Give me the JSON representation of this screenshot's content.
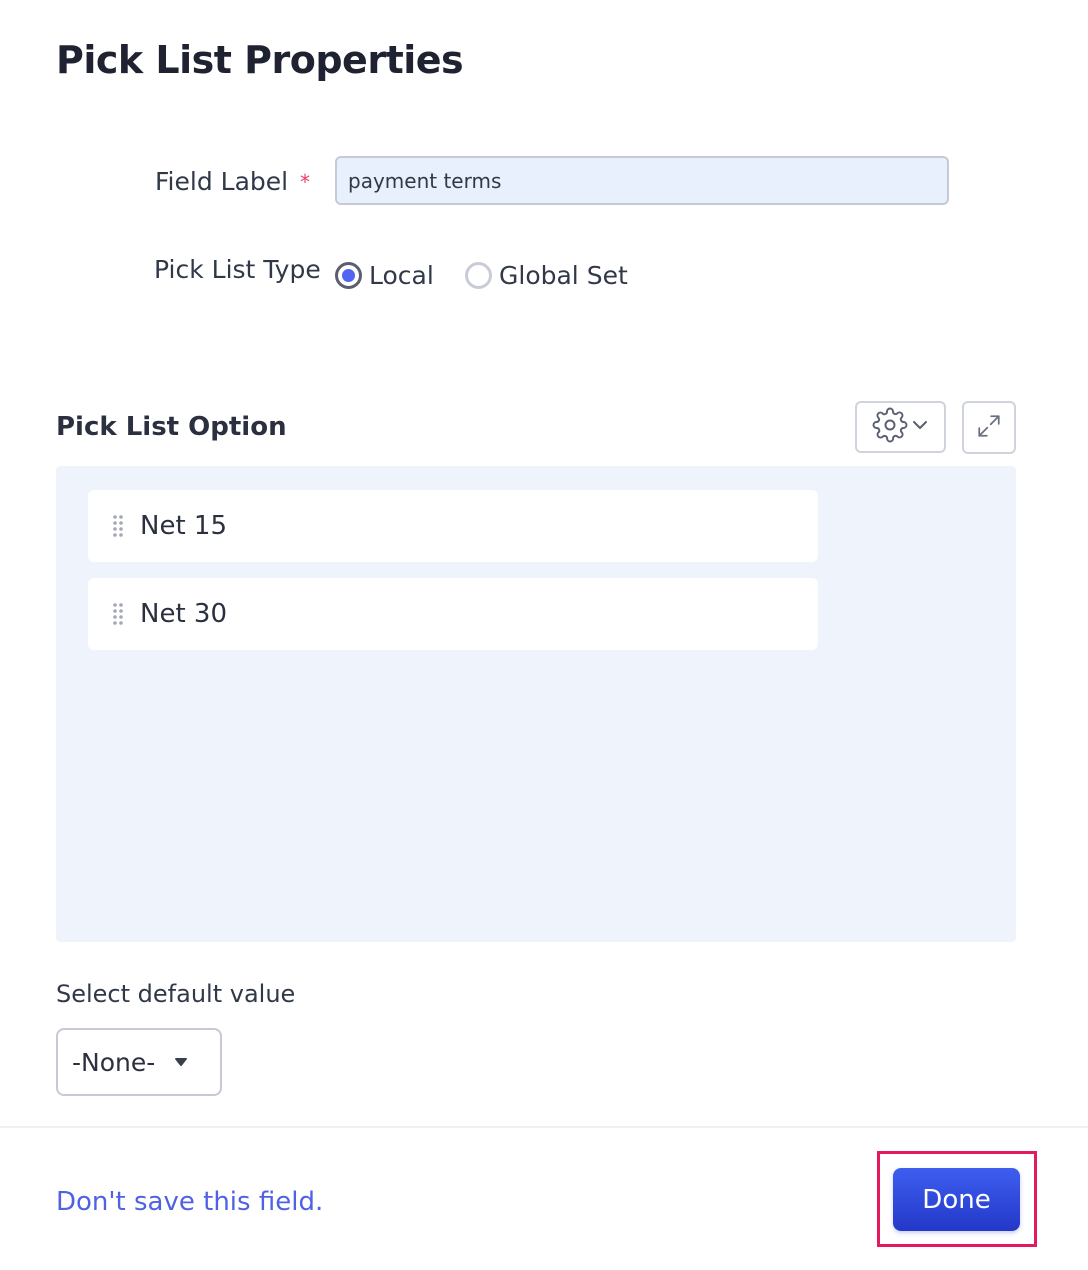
{
  "dialog": {
    "title": "Pick List Properties"
  },
  "field_label": {
    "label": "Field Label",
    "required_marker": "*",
    "value": "payment terms"
  },
  "pick_list_type": {
    "label": "Pick List Type",
    "options": [
      {
        "label": "Local",
        "selected": true
      },
      {
        "label": "Global Set",
        "selected": false
      }
    ]
  },
  "pick_list_option": {
    "title": "Pick List Option",
    "settings_icon": "gear-icon",
    "expand_icon": "expand-icon",
    "items": [
      {
        "label": "Net 15"
      },
      {
        "label": "Net 30"
      }
    ]
  },
  "default_value": {
    "label": "Select default value",
    "selected": "-None-"
  },
  "footer": {
    "discard_link": "Don't save this field.",
    "done_button": "Done"
  },
  "colors": {
    "accent": "#4f62e3",
    "primary_button": "#2f48dc",
    "required": "#e5406a",
    "highlight": "#e5195f",
    "panel_background": "#eef3fc",
    "input_background": "#e8effd"
  }
}
